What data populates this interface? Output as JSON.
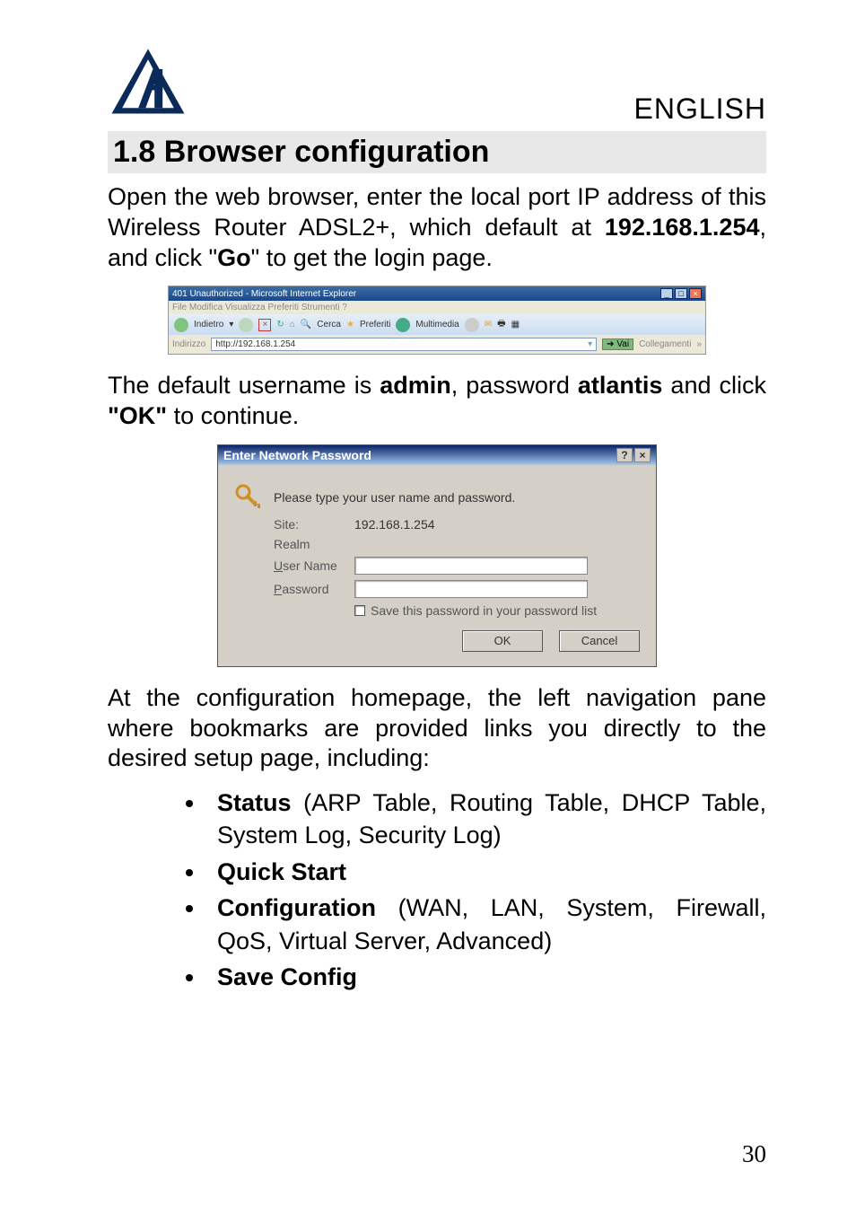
{
  "header": {
    "language": "ENGLISH"
  },
  "section": {
    "number": "1.8",
    "title": "Browser configuration"
  },
  "intro": {
    "text_pre": "Open the web browser, enter the local port IP address of this Wireless Router ADSL2+, which default at ",
    "ip": "192.168.1.254",
    "text_mid": ", and click \"",
    "go": "Go",
    "text_post": "\" to get the login page."
  },
  "ie": {
    "title": "401 Unauthorized - Microsoft Internet Explorer",
    "menu": "File   Modifica   Visualizza   Preferiti   Strumenti   ?",
    "toolbar": {
      "back": "Indietro",
      "search": "Cerca",
      "fav": "Preferiti",
      "media": "Multimedia"
    },
    "addr_label": "Indirizzo",
    "addr_value": "http://192.168.1.254",
    "go": "Vai",
    "links": "Collegamenti"
  },
  "auth_paragraph": {
    "pre": "The default username is ",
    "user": "admin",
    "mid": ", password ",
    "pass": "atlantis",
    "mid2": " and click ",
    "ok": "\"OK\"",
    "post": " to continue."
  },
  "dialog": {
    "title": "Enter Network Password",
    "prompt": "Please type your user name and password.",
    "site_label": "Site:",
    "site_value": "192.168.1.254",
    "realm_label": "Realm",
    "user_label_pre": "U",
    "user_label": "ser Name",
    "pass_label_pre": "P",
    "pass_label": "assword",
    "save_pre": "S",
    "save_label": "ave this password in your password list",
    "ok": "OK",
    "cancel": "Cancel"
  },
  "nav_paragraph": "At the configuration homepage, the left navigation pane where bookmarks are provided links you directly to the desired setup page, including:",
  "bullets": [
    {
      "bold": "Status",
      "rest": " (ARP Table, Routing Table, DHCP Table, System Log, Security Log)"
    },
    {
      "bold": "Quick Start",
      "rest": ""
    },
    {
      "bold": "Configuration",
      "rest": " (WAN, LAN, System, Firewall, QoS, Virtual Server, Advanced)"
    },
    {
      "bold": "Save Config",
      "rest": ""
    }
  ],
  "page_number": "30"
}
